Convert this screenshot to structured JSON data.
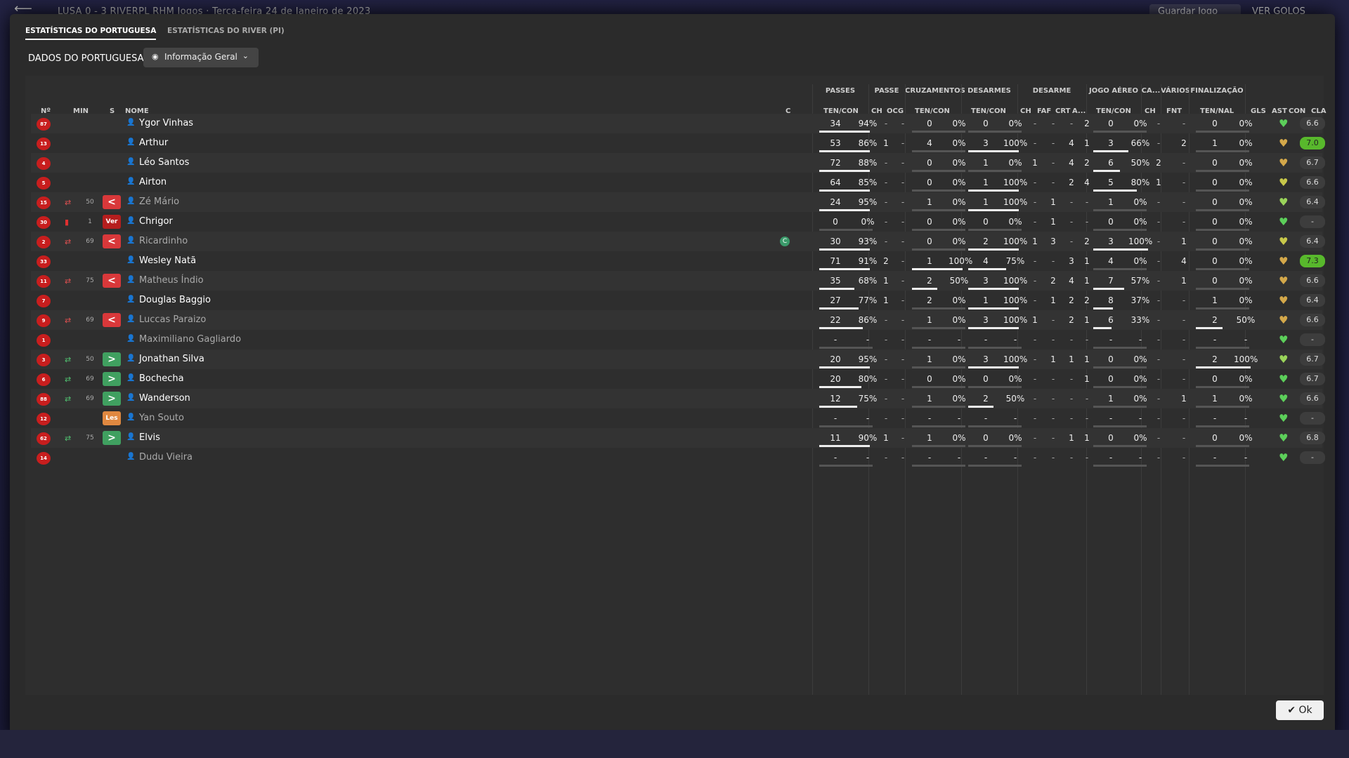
{
  "topbar": {
    "back": "⟵",
    "match": "LUSA  0 - 3  RIVERPL  RHM  Jogos  ·  Terça-feira 24 de Janeiro de 2023",
    "save": "Guardar Jogo",
    "goals": "VER GOLOS"
  },
  "tabs": [
    "ESTATÍSTICAS DO PORTUGUESA",
    "ESTATÍSTICAS DO RIVER (PI)"
  ],
  "section": {
    "title": "DADOS DO PORTUGUESA",
    "dropdown": "Informação Geral"
  },
  "groups": {
    "passes": "PASSES",
    "passe": "PASSE",
    "cruz": "CRUZAMENTOS",
    "desarmes": "DESARMES",
    "desarme": "DESARME",
    "jogo_aereo": "JOGO AÉREO",
    "ca": "CA...",
    "varios": "VÁRIOS",
    "finalizacao": "FINALIZAÇÃO"
  },
  "headers": {
    "no": "Nº",
    "min": "MIN",
    "s": "S",
    "nome": "NOME",
    "c": "C",
    "passes_tc": "TEN/CON",
    "ch": "CH",
    "ocg": "OCG",
    "cruz_tc": "TEN/CON",
    "des_tc": "TEN/CON",
    "d_ch": "CH",
    "faf": "FAF",
    "crt": "CRT",
    "a": "A...",
    "ja_tc": "TEN/CON",
    "ca_ch": "CH",
    "fnt": "FNT",
    "fin": "TEN/NAL",
    "gls": "GLS",
    "ast": "AST",
    "con": "CON",
    "cla": "CLA"
  },
  "players": [
    {
      "no": "87",
      "min": "",
      "s": "",
      "name": "Ygor Vinhas",
      "dim": false,
      "pa": "34",
      "pp": "94%",
      "pw": 72,
      "ch": "-",
      "ocg": "-",
      "ca": "0",
      "cp": "0%",
      "cw": 0,
      "da": "0",
      "dp": "0%",
      "dw": 0,
      "dch": "-",
      "faf": "-",
      "crt": "-",
      "a": "2",
      "ja": "0",
      "jp": "0%",
      "jw": 0,
      "cach": "-",
      "fnt": "-",
      "fa": "0",
      "fp": "0%",
      "fw": 0,
      "gls": "",
      "ast": "-",
      "heart": "#5ccf5a",
      "cla": "6.6",
      "good": false
    },
    {
      "no": "13",
      "min": "",
      "s": "",
      "name": "Arthur",
      "dim": false,
      "pa": "53",
      "pp": "86%",
      "pw": 72,
      "ch": "1",
      "ocg": "-",
      "ca": "4",
      "cp": "0%",
      "cw": 0,
      "da": "3",
      "dp": "100%",
      "dw": 72,
      "dch": "-",
      "faf": "-",
      "crt": "4",
      "a": "1",
      "ja": "3",
      "jp": "66%",
      "jw": 50,
      "cach": "-",
      "fnt": "2",
      "fa": "1",
      "fp": "0%",
      "fw": 0,
      "gls": "",
      "ast": "-",
      "heart": "#d4a84a",
      "cla": "7.0",
      "good": true
    },
    {
      "no": "4",
      "min": "",
      "s": "",
      "name": "Léo Santos",
      "dim": false,
      "pa": "72",
      "pp": "88%",
      "pw": 72,
      "ch": "-",
      "ocg": "-",
      "ca": "0",
      "cp": "0%",
      "cw": 0,
      "da": "1",
      "dp": "0%",
      "dw": 0,
      "dch": "1",
      "faf": "-",
      "crt": "4",
      "a": "2",
      "ja": "6",
      "jp": "50%",
      "jw": 38,
      "cach": "2",
      "fnt": "-",
      "fa": "0",
      "fp": "0%",
      "fw": 0,
      "gls": "",
      "ast": "-",
      "heart": "#d4a84a",
      "cla": "6.7",
      "good": false
    },
    {
      "no": "5",
      "min": "",
      "s": "",
      "name": "Airton",
      "dim": false,
      "pa": "64",
      "pp": "85%",
      "pw": 72,
      "ch": "-",
      "ocg": "-",
      "ca": "0",
      "cp": "0%",
      "cw": 0,
      "da": "1",
      "dp": "100%",
      "dw": 72,
      "dch": "-",
      "faf": "-",
      "crt": "2",
      "a": "4",
      "ja": "5",
      "jp": "80%",
      "jw": 62,
      "cach": "1",
      "fnt": "-",
      "fa": "0",
      "fp": "0%",
      "fw": 0,
      "gls": "",
      "ast": "-",
      "heart": "#c8c84a",
      "cla": "6.6",
      "good": false
    },
    {
      "no": "15",
      "min": "50",
      "s": "out",
      "name": "Zé Mário",
      "dim": true,
      "pa": "24",
      "pp": "95%",
      "pw": 72,
      "ch": "-",
      "ocg": "-",
      "ca": "1",
      "cp": "0%",
      "cw": 0,
      "da": "1",
      "dp": "100%",
      "dw": 72,
      "dch": "-",
      "faf": "1",
      "crt": "-",
      "a": "-",
      "ja": "1",
      "jp": "0%",
      "jw": 0,
      "cach": "-",
      "fnt": "-",
      "fa": "0",
      "fp": "0%",
      "fw": 0,
      "gls": "",
      "ast": "-",
      "heart": "#9ad45a",
      "cla": "6.4",
      "good": false
    },
    {
      "no": "30",
      "min": "1",
      "s": "ver",
      "name": "Chrigor",
      "dim": false,
      "pa": "0",
      "pp": "0%",
      "pw": 0,
      "ch": "-",
      "ocg": "-",
      "ca": "0",
      "cp": "0%",
      "cw": 0,
      "da": "0",
      "dp": "0%",
      "dw": 0,
      "dch": "-",
      "faf": "1",
      "crt": "-",
      "a": "-",
      "ja": "0",
      "jp": "0%",
      "jw": 0,
      "cach": "-",
      "fnt": "-",
      "fa": "0",
      "fp": "0%",
      "fw": 0,
      "gls": "",
      "ast": "-",
      "heart": "#5ccf5a",
      "cla": "-",
      "good": false
    },
    {
      "no": "2",
      "min": "69",
      "s": "out",
      "name": "Ricardinho",
      "dim": true,
      "cap": "C",
      "pa": "30",
      "pp": "93%",
      "pw": 72,
      "ch": "-",
      "ocg": "-",
      "ca": "0",
      "cp": "0%",
      "cw": 0,
      "da": "2",
      "dp": "100%",
      "dw": 72,
      "dch": "1",
      "faf": "3",
      "crt": "-",
      "a": "2",
      "ja": "3",
      "jp": "100%",
      "jw": 78,
      "cach": "-",
      "fnt": "1",
      "fa": "0",
      "fp": "0%",
      "fw": 0,
      "gls": "",
      "ast": "-",
      "heart": "#c8c84a",
      "cla": "6.4",
      "good": false
    },
    {
      "no": "33",
      "min": "",
      "s": "",
      "name": "Wesley Natã",
      "dim": false,
      "pa": "71",
      "pp": "91%",
      "pw": 72,
      "ch": "2",
      "ocg": "-",
      "ca": "1",
      "cp": "100%",
      "cw": 72,
      "da": "4",
      "dp": "75%",
      "dw": 54,
      "dch": "-",
      "faf": "-",
      "crt": "3",
      "a": "1",
      "ja": "4",
      "jp": "0%",
      "jw": 0,
      "cach": "-",
      "fnt": "4",
      "fa": "0",
      "fp": "0%",
      "fw": 0,
      "gls": "",
      "ast": "-",
      "heart": "#d4a84a",
      "cla": "7.3",
      "good": true
    },
    {
      "no": "11",
      "min": "75",
      "s": "out",
      "name": "Matheus Índio",
      "dim": true,
      "pa": "35",
      "pp": "68%",
      "pw": 50,
      "ch": "1",
      "ocg": "-",
      "ca": "2",
      "cp": "50%",
      "cw": 36,
      "da": "3",
      "dp": "100%",
      "dw": 72,
      "dch": "-",
      "faf": "2",
      "crt": "4",
      "a": "1",
      "ja": "7",
      "jp": "57%",
      "jw": 44,
      "cach": "-",
      "fnt": "1",
      "fa": "0",
      "fp": "0%",
      "fw": 0,
      "gls": "",
      "ast": "-",
      "heart": "#d4a84a",
      "cla": "6.6",
      "good": false
    },
    {
      "no": "7",
      "min": "",
      "s": "",
      "name": "Douglas Baggio",
      "dim": false,
      "pa": "27",
      "pp": "77%",
      "pw": 56,
      "ch": "1",
      "ocg": "-",
      "ca": "2",
      "cp": "0%",
      "cw": 0,
      "da": "1",
      "dp": "100%",
      "dw": 72,
      "dch": "-",
      "faf": "1",
      "crt": "2",
      "a": "2",
      "ja": "8",
      "jp": "37%",
      "jw": 28,
      "cach": "-",
      "fnt": "-",
      "fa": "1",
      "fp": "0%",
      "fw": 0,
      "gls": "",
      "ast": "-",
      "heart": "#d4a84a",
      "cla": "6.4",
      "good": false
    },
    {
      "no": "9",
      "min": "69",
      "s": "out",
      "name": "Luccas Paraizo",
      "dim": true,
      "pa": "22",
      "pp": "86%",
      "pw": 62,
      "ch": "-",
      "ocg": "-",
      "ca": "1",
      "cp": "0%",
      "cw": 0,
      "da": "3",
      "dp": "100%",
      "dw": 72,
      "dch": "1",
      "faf": "-",
      "crt": "2",
      "a": "1",
      "ja": "6",
      "jp": "33%",
      "jw": 26,
      "cach": "-",
      "fnt": "-",
      "fa": "2",
      "fp": "50%",
      "fw": 38,
      "gls": "",
      "ast": "-",
      "heart": "#d4a84a",
      "cla": "6.6",
      "good": false
    },
    {
      "no": "1",
      "min": "",
      "s": "",
      "name": "Maximiliano Gagliardo",
      "dim": true,
      "pa": "-",
      "pp": "-",
      "pw": 0,
      "ch": "-",
      "ocg": "-",
      "ca": "-",
      "cp": "-",
      "cw": 0,
      "da": "-",
      "dp": "-",
      "dw": 0,
      "dch": "-",
      "faf": "-",
      "crt": "-",
      "a": "-",
      "ja": "-",
      "jp": "-",
      "jw": 0,
      "cach": "-",
      "fnt": "-",
      "fa": "-",
      "fp": "-",
      "fw": 0,
      "gls": "",
      "ast": "-",
      "heart": "#5ccf5a",
      "cla": "-",
      "good": false
    },
    {
      "no": "3",
      "min": "50",
      "s": "in",
      "name": "Jonathan Silva",
      "dim": false,
      "pa": "20",
      "pp": "95%",
      "pw": 72,
      "ch": "-",
      "ocg": "-",
      "ca": "1",
      "cp": "0%",
      "cw": 0,
      "da": "3",
      "dp": "100%",
      "dw": 72,
      "dch": "-",
      "faf": "1",
      "crt": "1",
      "a": "1",
      "ja": "0",
      "jp": "0%",
      "jw": 0,
      "cach": "-",
      "fnt": "-",
      "fa": "2",
      "fp": "100%",
      "fw": 78,
      "gls": "",
      "ast": "-",
      "heart": "#9ad45a",
      "cla": "6.7",
      "good": false
    },
    {
      "no": "6",
      "min": "69",
      "s": "in",
      "name": "Bochecha",
      "dim": false,
      "pa": "20",
      "pp": "80%",
      "pw": 60,
      "ch": "-",
      "ocg": "-",
      "ca": "0",
      "cp": "0%",
      "cw": 0,
      "da": "0",
      "dp": "0%",
      "dw": 0,
      "dch": "-",
      "faf": "-",
      "crt": "-",
      "a": "1",
      "ja": "0",
      "jp": "0%",
      "jw": 0,
      "cach": "-",
      "fnt": "-",
      "fa": "0",
      "fp": "0%",
      "fw": 0,
      "gls": "",
      "ast": "-",
      "heart": "#5ccf5a",
      "cla": "6.7",
      "good": false
    },
    {
      "no": "88",
      "min": "69",
      "s": "in",
      "name": "Wanderson",
      "dim": false,
      "pa": "12",
      "pp": "75%",
      "pw": 54,
      "ch": "-",
      "ocg": "-",
      "ca": "1",
      "cp": "0%",
      "cw": 0,
      "da": "2",
      "dp": "50%",
      "dw": 36,
      "dch": "-",
      "faf": "-",
      "crt": "-",
      "a": "-",
      "ja": "1",
      "jp": "0%",
      "jw": 0,
      "cach": "-",
      "fnt": "1",
      "fa": "1",
      "fp": "0%",
      "fw": 0,
      "gls": "",
      "ast": "-",
      "heart": "#5ccf5a",
      "cla": "6.6",
      "good": false
    },
    {
      "no": "12",
      "min": "",
      "s": "les",
      "name": "Yan Souto",
      "dim": true,
      "pa": "-",
      "pp": "-",
      "pw": 0,
      "ch": "-",
      "ocg": "-",
      "ca": "-",
      "cp": "-",
      "cw": 0,
      "da": "-",
      "dp": "-",
      "dw": 0,
      "dch": "-",
      "faf": "-",
      "crt": "-",
      "a": "-",
      "ja": "-",
      "jp": "-",
      "jw": 0,
      "cach": "-",
      "fnt": "-",
      "fa": "-",
      "fp": "-",
      "fw": 0,
      "gls": "",
      "ast": "-",
      "heart": "#5ccf5a",
      "cla": "-",
      "good": false
    },
    {
      "no": "62",
      "min": "75",
      "s": "in",
      "name": "Elvis",
      "dim": false,
      "pa": "11",
      "pp": "90%",
      "pw": 72,
      "ch": "1",
      "ocg": "-",
      "ca": "1",
      "cp": "0%",
      "cw": 0,
      "da": "0",
      "dp": "0%",
      "dw": 0,
      "dch": "-",
      "faf": "-",
      "crt": "1",
      "a": "1",
      "ja": "0",
      "jp": "0%",
      "jw": 0,
      "cach": "-",
      "fnt": "-",
      "fa": "0",
      "fp": "0%",
      "fw": 0,
      "gls": "",
      "ast": "-",
      "heart": "#5ccf5a",
      "cla": "6.8",
      "good": false
    },
    {
      "no": "14",
      "min": "",
      "s": "",
      "name": "Dudu Vieira",
      "dim": true,
      "pa": "-",
      "pp": "-",
      "pw": 0,
      "ch": "-",
      "ocg": "-",
      "ca": "-",
      "cp": "-",
      "cw": 0,
      "da": "-",
      "dp": "-",
      "dw": 0,
      "dch": "-",
      "faf": "-",
      "crt": "-",
      "a": "-",
      "ja": "-",
      "jp": "-",
      "jw": 0,
      "cach": "-",
      "fnt": "-",
      "fa": "-",
      "fp": "-",
      "fw": 0,
      "gls": "",
      "ast": "-",
      "heart": "#5ccf5a",
      "cla": "-",
      "good": false
    }
  ],
  "ok": "Ok",
  "sub_labels": {
    "out": "<",
    "in": ">",
    "ver": "Ver",
    "les": "Les"
  }
}
